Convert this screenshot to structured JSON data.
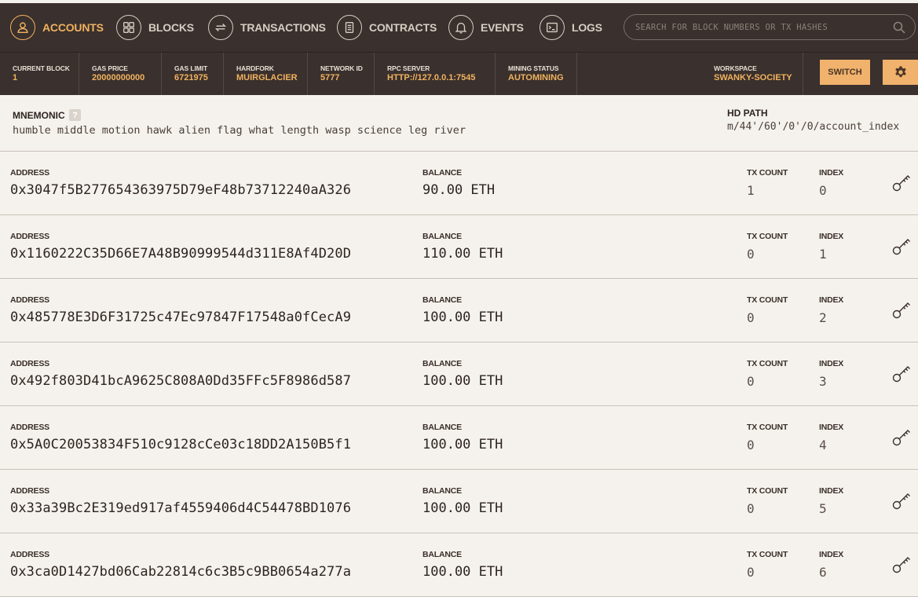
{
  "nav": {
    "items": [
      {
        "label": "Accounts",
        "icon": "user-icon",
        "active": true
      },
      {
        "label": "Blocks",
        "icon": "blocks-icon",
        "active": false
      },
      {
        "label": "Transactions",
        "icon": "transfer-icon",
        "active": false
      },
      {
        "label": "Contracts",
        "icon": "document-icon",
        "active": false
      },
      {
        "label": "Events",
        "icon": "bell-icon",
        "active": false
      },
      {
        "label": "Logs",
        "icon": "terminal-icon",
        "active": false
      }
    ],
    "search_placeholder": "SEARCH FOR BLOCK NUMBERS OR TX HASHES"
  },
  "status": {
    "current_block": {
      "label": "Current Block",
      "value": "1"
    },
    "gas_price": {
      "label": "Gas Price",
      "value": "20000000000"
    },
    "gas_limit": {
      "label": "Gas Limit",
      "value": "6721975"
    },
    "hardfork": {
      "label": "Hardfork",
      "value": "MUIRGLACIER"
    },
    "network_id": {
      "label": "Network ID",
      "value": "5777"
    },
    "rpc_server": {
      "label": "RPC Server",
      "value": "HTTP://127.0.0.1:7545"
    },
    "mining_status": {
      "label": "Mining Status",
      "value": "AUTOMINING"
    },
    "workspace": {
      "label": "Workspace",
      "value": "SWANKY-SOCIETY"
    },
    "switch_label": "Switch"
  },
  "mnemonic": {
    "label": "Mnemonic",
    "help": "?",
    "words": "humble middle motion hawk alien flag what length wasp science leg river",
    "hd_path_label": "HD Path",
    "hd_path": "m/44'/60'/0'/0/account_index"
  },
  "account_labels": {
    "address": "Address",
    "balance": "Balance",
    "tx_count": "TX Count",
    "index": "Index"
  },
  "accounts": [
    {
      "address": "0x3047f5B277654363975D79eF48b73712240aA326",
      "balance": "90.00 ETH",
      "tx_count": "1",
      "index": "0"
    },
    {
      "address": "0x1160222C35D66E7A48B90999544d311E8Af4D20D",
      "balance": "110.00 ETH",
      "tx_count": "0",
      "index": "1"
    },
    {
      "address": "0x485778E3D6F31725c47Ec97847F17548a0fCecA9",
      "balance": "100.00 ETH",
      "tx_count": "0",
      "index": "2"
    },
    {
      "address": "0x492f803D41bcA9625C808A0Dd35FFc5F8986d587",
      "balance": "100.00 ETH",
      "tx_count": "0",
      "index": "3"
    },
    {
      "address": "0x5A0C20053834F510c9128cCe03c18DD2A150B5f1",
      "balance": "100.00 ETH",
      "tx_count": "0",
      "index": "4"
    },
    {
      "address": "0x33a39Bc2E319ed917af4559406d4C54478BD1076",
      "balance": "100.00 ETH",
      "tx_count": "0",
      "index": "5"
    },
    {
      "address": "0x3ca0D1427bd06Cab22814c6c3B5c9BB0654a277a",
      "balance": "100.00 ETH",
      "tx_count": "0",
      "index": "6"
    }
  ],
  "colors": {
    "nav_bg": "#3a302d",
    "accent": "#f0b260",
    "button_bg": "#f0b26c",
    "page_bg": "#f5f2ed"
  }
}
